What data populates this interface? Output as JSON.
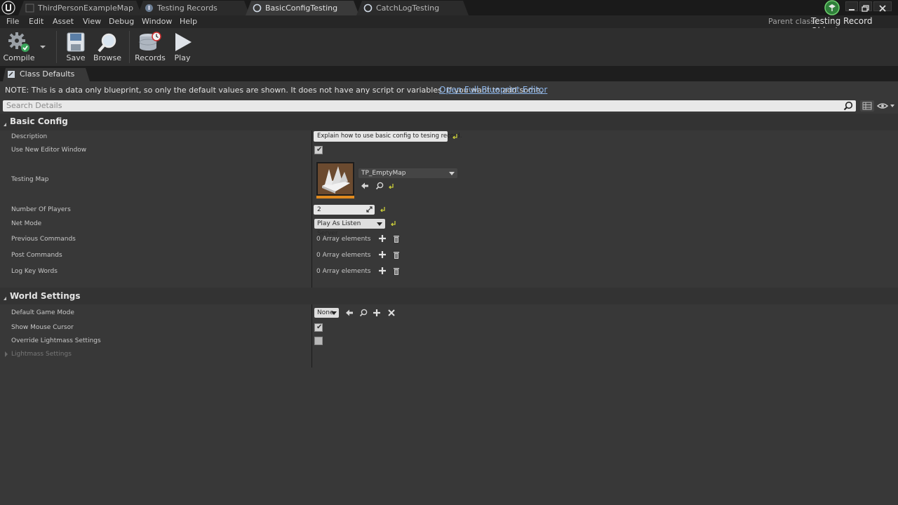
{
  "tabs": [
    {
      "label": "ThirdPersonExampleMap",
      "icon": "level-icon"
    },
    {
      "label": "Testing Records",
      "icon": "testing-records-icon"
    },
    {
      "label": "BasicConfigTesting",
      "icon": "blueprint-icon"
    },
    {
      "label": "CatchLogTesting",
      "icon": "blueprint-icon"
    }
  ],
  "menu": [
    "File",
    "Edit",
    "Asset",
    "View",
    "Debug",
    "Window",
    "Help"
  ],
  "parent_class": {
    "label": "Parent class:",
    "value": "Testing Record Object"
  },
  "toolbar": {
    "compile": "Compile",
    "save": "Save",
    "browse": "Browse",
    "records": "Records",
    "play": "Play"
  },
  "class_defaults_tab": "Class Defaults",
  "note": {
    "text": "NOTE: This is a data only blueprint, so only the default values are shown.  It does not have any script or variables.  If you want to add some,",
    "link": "Open Full Blueprint Editor"
  },
  "search": {
    "placeholder": "Search Details"
  },
  "basic_config": {
    "title": "Basic Config",
    "description_label": "Description",
    "description_value": "Explain how to use basic config to tesing record.",
    "use_new_editor_window_label": "Use New Editor Window",
    "use_new_editor_window_checked": true,
    "testing_map_label": "Testing Map",
    "testing_map_value": "TP_EmptyMap",
    "number_of_players_label": "Number Of Players",
    "number_of_players_value": "2",
    "net_mode_label": "Net Mode",
    "net_mode_value": "Play As Listen Server",
    "previous_commands_label": "Previous Commands",
    "previous_commands_value": "0 Array elements",
    "post_commands_label": "Post Commands",
    "post_commands_value": "0 Array elements",
    "log_key_words_label": "Log Key Words",
    "log_key_words_value": "0 Array elements"
  },
  "world_settings": {
    "title": "World Settings",
    "default_game_mode_label": "Default Game Mode",
    "default_game_mode_value": "None",
    "show_mouse_cursor_label": "Show Mouse Cursor",
    "show_mouse_cursor_checked": true,
    "override_lightmass_label": "Override Lightmass Settings",
    "override_lightmass_checked": false,
    "lightmass_settings_label": "Lightmass Settings"
  }
}
